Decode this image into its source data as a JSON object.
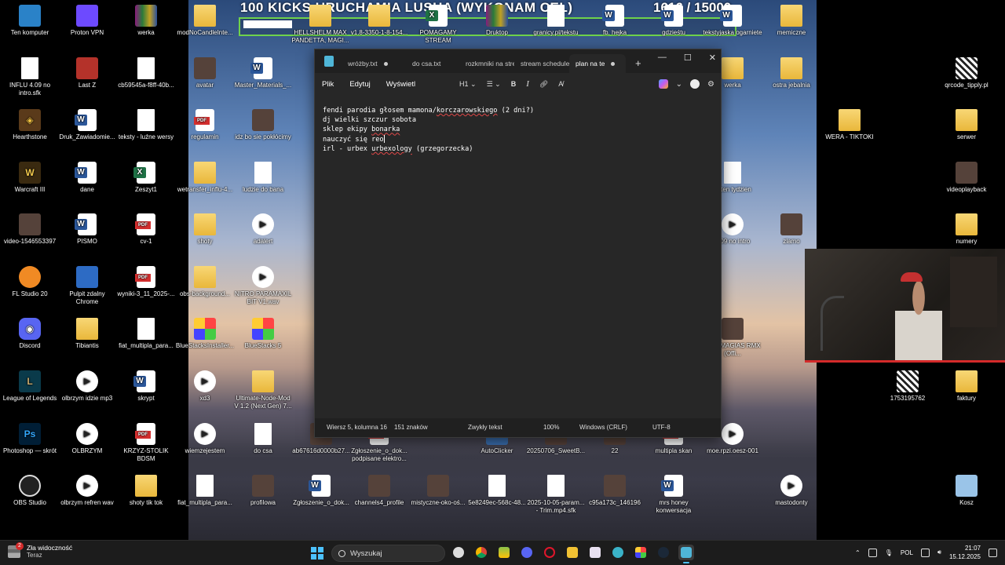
{
  "overlay": {
    "goal_text": "100 KICKS URUCHAMIA LUSHA (WYKONAM CEL)",
    "counter_text": "1616   / 15000"
  },
  "desktop_left": [
    {
      "label": "Ten komputer",
      "icon": "computer-icon"
    },
    {
      "label": "Proton VPN",
      "icon": "proton-vpn-icon"
    },
    {
      "label": "werka",
      "icon": "archive-icon"
    },
    {
      "label": "INFLU 4.09 no intro.sfk",
      "icon": "file-icon"
    },
    {
      "label": "Last Z",
      "icon": "game-icon"
    },
    {
      "label": "cb59545a-f8ff-40b...",
      "icon": "file-icon"
    },
    {
      "label": "Hearthstone",
      "icon": "hearthstone-icon"
    },
    {
      "label": "Druk_Zawiadomie...",
      "icon": "word-doc-icon"
    },
    {
      "label": "teksty - luźne wersy",
      "icon": "text-file-icon"
    },
    {
      "label": "Warcraft III",
      "icon": "warcraft-icon"
    },
    {
      "label": "dane",
      "icon": "word-doc-icon"
    },
    {
      "label": "Zeszyt1",
      "icon": "excel-icon"
    },
    {
      "label": "video-1546553397",
      "icon": "video-icon"
    },
    {
      "label": "PISMO",
      "icon": "word-doc-icon"
    },
    {
      "label": "cv-1",
      "icon": "pdf-icon"
    },
    {
      "label": "FL Studio 20",
      "icon": "fl-studio-icon"
    },
    {
      "label": "Pulpit zdalny Chrome",
      "icon": "remote-desktop-icon"
    },
    {
      "label": "wyniki-3_11_2025-...",
      "icon": "pdf-icon"
    },
    {
      "label": "Discord",
      "icon": "discord-icon"
    },
    {
      "label": "Tibiantis",
      "icon": "folder-icon"
    },
    {
      "label": "fiat_multipla_para...",
      "icon": "blank-file-icon"
    },
    {
      "label": "League of Legends",
      "icon": "league-icon"
    },
    {
      "label": "olbrzym idzie mp3",
      "icon": "audio-icon"
    },
    {
      "label": "skrypt",
      "icon": "word-doc-icon"
    },
    {
      "label": "Photoshop — skrót",
      "icon": "photoshop-icon"
    },
    {
      "label": "OLBRZYM",
      "icon": "media-icon"
    },
    {
      "label": "KRZYZ-STOLIK BDSM",
      "icon": "pdf-icon"
    },
    {
      "label": "OBS Studio",
      "icon": "obs-icon"
    },
    {
      "label": "olbrzym refren wav",
      "icon": "media-icon"
    },
    {
      "label": "shoty tik tok",
      "icon": "folder-icon"
    }
  ],
  "desktop_middle": [
    {
      "label": "modNoCandleInte...",
      "icon": "folder-icon"
    },
    {
      "label": "avatar",
      "icon": "image-icon"
    },
    {
      "label": "Master_Materials_...",
      "icon": "word-doc-icon"
    },
    {
      "label": "regulamin",
      "icon": "pdf-icon"
    },
    {
      "label": "idz bo sie pokłócimy",
      "icon": "video-icon"
    },
    {
      "label": "wetransfer_influ-4...",
      "icon": "folder-icon"
    },
    {
      "label": "ludzie do bana",
      "icon": "blank-file-icon"
    },
    {
      "label": "shoty",
      "icon": "folder-icon"
    },
    {
      "label": "adalert",
      "icon": "media-icon"
    },
    {
      "label": "obs-background...",
      "icon": "folder-icon"
    },
    {
      "label": "NITRO PARAMAXIL BIT V1.wav",
      "icon": "audio-icon"
    },
    {
      "label": "BlueStacksInstaller...",
      "icon": "bluestacks-icon"
    },
    {
      "label": "BlueStacks 5",
      "icon": "bluestacks-icon"
    },
    {
      "label": "xd3",
      "icon": "media-icon"
    },
    {
      "label": "Ultimate-Node-Mod V 1.2 (Next Gen) 7...",
      "icon": "folder-icon"
    },
    {
      "label": "wiemzejestem",
      "icon": "media-icon"
    },
    {
      "label": "do csa",
      "icon": "text-file-icon"
    },
    {
      "label": "fiat_multipla_para...",
      "icon": "blank-file-icon"
    },
    {
      "label": "profilowa",
      "icon": "image-icon"
    },
    {
      "label": "Zgłoszenie_o_dok...",
      "icon": "word-doc-icon"
    },
    {
      "label": "channels4_profile",
      "icon": "image-icon"
    },
    {
      "label": "mistyczne-oko-oś...",
      "icon": "image-icon"
    },
    {
      "label": "5e8249ec-568c-48...",
      "icon": "blank-file-icon"
    },
    {
      "label": "2025-10-05-param... - Trim.mp4.sfk",
      "icon": "file-icon"
    },
    {
      "label": "c95a173c_146196",
      "icon": "image-icon"
    },
    {
      "label": "mrs honey konwersacja",
      "icon": "word-doc-icon"
    },
    {
      "label": "mastodonty",
      "icon": "media-icon"
    },
    {
      "label": "ab67616d0000b27...",
      "icon": "image-icon"
    },
    {
      "label": "Zgłoszenie_o_dok... podpisane elektro...",
      "icon": "pdf-icon"
    },
    {
      "label": "AutoClicker",
      "icon": "app-icon"
    },
    {
      "label": "20250706_SweetB...",
      "icon": "video-icon"
    },
    {
      "label": "22",
      "icon": "image-icon"
    },
    {
      "label": "multipla skan",
      "icon": "pdf-icon"
    },
    {
      "label": "moe.rpzi.oesz-001",
      "icon": "media-icon"
    }
  ],
  "desktop_top_row": [
    {
      "label": "HELLSHELM MAX PANDETTA, MAGI...",
      "icon": "folder-icon"
    },
    {
      "label": "v1.8-3350-1-8-154...",
      "icon": "folder-icon"
    },
    {
      "label": "POMAGAMY STREAM",
      "icon": "excel-icon"
    },
    {
      "label": "Druktop",
      "icon": "archive-icon"
    },
    {
      "label": "granicy.pl/tekstu",
      "icon": "file-icon"
    },
    {
      "label": "fb. hejka",
      "icon": "word-doc-icon"
    },
    {
      "label": "gdzieśtu",
      "icon": "word-doc-icon"
    },
    {
      "label": "tekstyjaska ogarniete",
      "icon": "word-doc-icon"
    }
  ],
  "desktop_right": [
    {
      "label": "memiczne",
      "icon": "folder-icon"
    },
    {
      "label": "qrcode_tipply.pl",
      "icon": "qr-icon"
    },
    {
      "label": "werka",
      "icon": "folder-icon"
    },
    {
      "label": "ostra jebalnia",
      "icon": "folder-icon"
    },
    {
      "label": "WERA - TIKTOKI",
      "icon": "folder-icon"
    },
    {
      "label": "serwer",
      "icon": "folder-icon"
    },
    {
      "label": "videoplayback",
      "icon": "video-icon"
    },
    {
      "label": "nt ten tydzien",
      "icon": "text-file-icon"
    },
    {
      "label": "numery",
      "icon": "folder-icon"
    },
    {
      "label": "4.09 no intro",
      "icon": "media-icon"
    },
    {
      "label": "zlamo",
      "icon": "image-icon"
    },
    {
      "label": "ELD, MAGIAS RMX (Offi...",
      "icon": "image-icon"
    },
    {
      "label": "1753195762",
      "icon": "qr-icon"
    },
    {
      "label": "faktury",
      "icon": "folder-icon"
    },
    {
      "label": "Kosz",
      "icon": "recycle-bin-icon"
    }
  ],
  "notepad": {
    "tabs": [
      {
        "label": "wróżby.txt",
        "modified": true
      },
      {
        "label": "do csa.txt",
        "modified": false
      },
      {
        "label": "rozkmniki na stre",
        "modified": false
      },
      {
        "label": "stream schedule",
        "modified": false
      },
      {
        "label": "plan na te",
        "modified": true,
        "active": true
      }
    ],
    "new_tab": "+",
    "menu": {
      "file": "Plik",
      "edit": "Edytuj",
      "view": "Wyświetl"
    },
    "format": {
      "heading": "H1",
      "bold": "B",
      "italic": "I"
    },
    "lines": [
      {
        "pre": "fendi parodia głosem mamona/",
        "spell": "korczarowskiego",
        "post": " (2 dni?)"
      },
      {
        "pre": "dj wielki szczur sobota",
        "spell": "",
        "post": ""
      },
      {
        "pre": "sklep ekipy ",
        "spell": "bonarka",
        "post": ""
      },
      {
        "pre": "nauczyć się reo",
        "spell": "",
        "post": ""
      },
      {
        "pre": "irl - urbex ",
        "spell": "urbexology",
        "post": " (grzegorzecka)"
      }
    ],
    "status": {
      "position": "Wiersz 5, kolumna 16",
      "chars": "151 znaków",
      "format": "Zwykły tekst",
      "zoom": "100%",
      "eol": "Windows (CRLF)",
      "encoding": "UTF-8"
    }
  },
  "taskbar": {
    "weather_title": "Zła widoczność",
    "weather_sub": "Teraz",
    "notification_count": "2",
    "search_placeholder": "Wyszukaj",
    "language": "POL",
    "time": "21:07",
    "date": "15.12.2025"
  }
}
